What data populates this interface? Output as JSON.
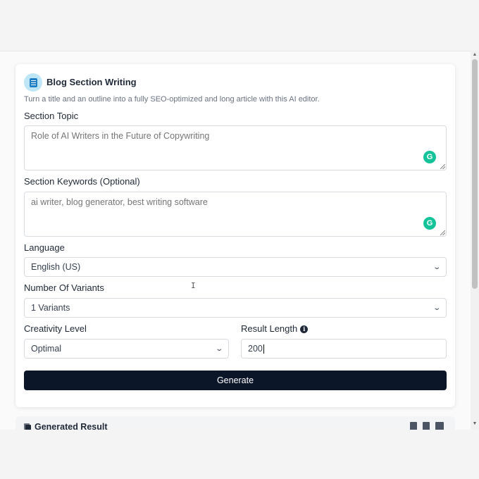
{
  "card": {
    "title": "Blog Section Writing",
    "subtitle": "Turn a title and an outline into a fully SEO-optimized and long article with this AI editor."
  },
  "form": {
    "section_topic": {
      "label": "Section Topic",
      "placeholder": "Role of AI Writers in the Future of Copywriting"
    },
    "section_keywords": {
      "label": "Section Keywords (Optional)",
      "placeholder": "ai writer, blog generator, best writing software"
    },
    "language": {
      "label": "Language",
      "selected": "English (US)"
    },
    "variants": {
      "label": "Number Of Variants",
      "selected": "1 Variants"
    },
    "creativity": {
      "label": "Creativity Level",
      "selected": "Optimal"
    },
    "result_length": {
      "label": "Result Length",
      "value": "200"
    },
    "generate_label": "Generate"
  },
  "result": {
    "title": "Generated Result"
  },
  "icons": {
    "header": "document-icon",
    "grammarly": "grammarly-icon",
    "grammarly_glyph": "G",
    "info": "info-icon",
    "info_glyph": "i",
    "chevron": "chevron-down-icon",
    "chevron_glyph": "⌄",
    "text_cursor_glyph": "I",
    "scroll_up_glyph": "▲",
    "scroll_down_glyph": "▼"
  },
  "colors": {
    "button_bg": "#0b1629",
    "grammarly": "#15c39a",
    "header_icon_bg": "#bfe6f7",
    "header_icon_fg": "#1d7fc7"
  }
}
